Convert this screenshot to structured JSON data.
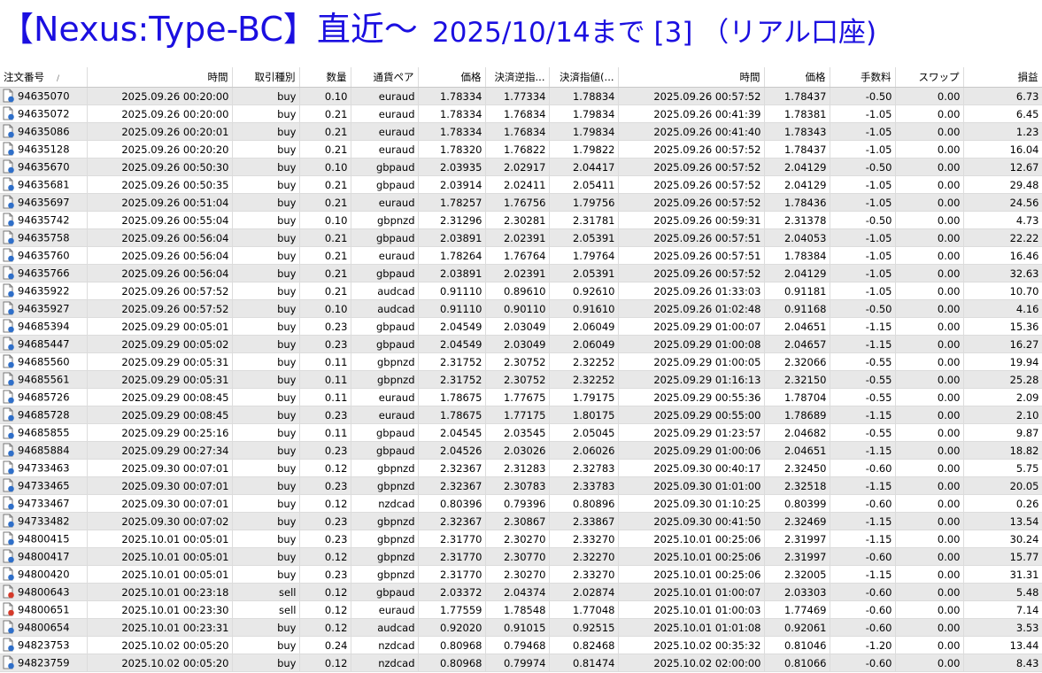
{
  "title": {
    "part1": "【Nexus:Type-BC】直近～",
    "part2": "2025/10/14まで [3] （リアル口座)"
  },
  "table": {
    "headers": [
      "注文番号",
      "時間",
      "取引種別",
      "数量",
      "通貨ペア",
      "価格",
      "決済逆指...",
      "決済指値(...",
      "時間",
      "価格",
      "手数料",
      "スワップ",
      "損益"
    ],
    "sort_indicator": "/",
    "colors": {
      "buy_icon": "#2f6fc9",
      "sell_icon": "#d53a2a"
    },
    "rows": [
      [
        "94635070",
        "2025.09.26 00:20:00",
        "buy",
        "0.10",
        "euraud",
        "1.78334",
        "1.77334",
        "1.78834",
        "2025.09.26 00:57:52",
        "1.78437",
        "-0.50",
        "0.00",
        "6.73"
      ],
      [
        "94635072",
        "2025.09.26 00:20:00",
        "buy",
        "0.21",
        "euraud",
        "1.78334",
        "1.76834",
        "1.79834",
        "2025.09.26 00:41:39",
        "1.78381",
        "-1.05",
        "0.00",
        "6.45"
      ],
      [
        "94635086",
        "2025.09.26 00:20:01",
        "buy",
        "0.21",
        "euraud",
        "1.78334",
        "1.76834",
        "1.79834",
        "2025.09.26 00:41:40",
        "1.78343",
        "-1.05",
        "0.00",
        "1.23"
      ],
      [
        "94635128",
        "2025.09.26 00:20:20",
        "buy",
        "0.21",
        "euraud",
        "1.78320",
        "1.76822",
        "1.79822",
        "2025.09.26 00:57:52",
        "1.78437",
        "-1.05",
        "0.00",
        "16.04"
      ],
      [
        "94635670",
        "2025.09.26 00:50:30",
        "buy",
        "0.10",
        "gbpaud",
        "2.03935",
        "2.02917",
        "2.04417",
        "2025.09.26 00:57:52",
        "2.04129",
        "-0.50",
        "0.00",
        "12.67"
      ],
      [
        "94635681",
        "2025.09.26 00:50:35",
        "buy",
        "0.21",
        "gbpaud",
        "2.03914",
        "2.02411",
        "2.05411",
        "2025.09.26 00:57:52",
        "2.04129",
        "-1.05",
        "0.00",
        "29.48"
      ],
      [
        "94635697",
        "2025.09.26 00:51:04",
        "buy",
        "0.21",
        "euraud",
        "1.78257",
        "1.76756",
        "1.79756",
        "2025.09.26 00:57:52",
        "1.78436",
        "-1.05",
        "0.00",
        "24.56"
      ],
      [
        "94635742",
        "2025.09.26 00:55:04",
        "buy",
        "0.10",
        "gbpnzd",
        "2.31296",
        "2.30281",
        "2.31781",
        "2025.09.26 00:59:31",
        "2.31378",
        "-0.50",
        "0.00",
        "4.73"
      ],
      [
        "94635758",
        "2025.09.26 00:56:04",
        "buy",
        "0.21",
        "gbpaud",
        "2.03891",
        "2.02391",
        "2.05391",
        "2025.09.26 00:57:51",
        "2.04053",
        "-1.05",
        "0.00",
        "22.22"
      ],
      [
        "94635760",
        "2025.09.26 00:56:04",
        "buy",
        "0.21",
        "euraud",
        "1.78264",
        "1.76764",
        "1.79764",
        "2025.09.26 00:57:51",
        "1.78384",
        "-1.05",
        "0.00",
        "16.46"
      ],
      [
        "94635766",
        "2025.09.26 00:56:04",
        "buy",
        "0.21",
        "gbpaud",
        "2.03891",
        "2.02391",
        "2.05391",
        "2025.09.26 00:57:52",
        "2.04129",
        "-1.05",
        "0.00",
        "32.63"
      ],
      [
        "94635922",
        "2025.09.26 00:57:52",
        "buy",
        "0.21",
        "audcad",
        "0.91110",
        "0.89610",
        "0.92610",
        "2025.09.26 01:33:03",
        "0.91181",
        "-1.05",
        "0.00",
        "10.70"
      ],
      [
        "94635927",
        "2025.09.26 00:57:52",
        "buy",
        "0.10",
        "audcad",
        "0.91110",
        "0.90110",
        "0.91610",
        "2025.09.26 01:02:48",
        "0.91168",
        "-0.50",
        "0.00",
        "4.16"
      ],
      [
        "94685394",
        "2025.09.29 00:05:01",
        "buy",
        "0.23",
        "gbpaud",
        "2.04549",
        "2.03049",
        "2.06049",
        "2025.09.29 01:00:07",
        "2.04651",
        "-1.15",
        "0.00",
        "15.36"
      ],
      [
        "94685447",
        "2025.09.29 00:05:02",
        "buy",
        "0.23",
        "gbpaud",
        "2.04549",
        "2.03049",
        "2.06049",
        "2025.09.29 01:00:08",
        "2.04657",
        "-1.15",
        "0.00",
        "16.27"
      ],
      [
        "94685560",
        "2025.09.29 00:05:31",
        "buy",
        "0.11",
        "gbpnzd",
        "2.31752",
        "2.30752",
        "2.32252",
        "2025.09.29 01:00:05",
        "2.32066",
        "-0.55",
        "0.00",
        "19.94"
      ],
      [
        "94685561",
        "2025.09.29 00:05:31",
        "buy",
        "0.11",
        "gbpnzd",
        "2.31752",
        "2.30752",
        "2.32252",
        "2025.09.29 01:16:13",
        "2.32150",
        "-0.55",
        "0.00",
        "25.28"
      ],
      [
        "94685726",
        "2025.09.29 00:08:45",
        "buy",
        "0.11",
        "euraud",
        "1.78675",
        "1.77675",
        "1.79175",
        "2025.09.29 00:55:36",
        "1.78704",
        "-0.55",
        "0.00",
        "2.09"
      ],
      [
        "94685728",
        "2025.09.29 00:08:45",
        "buy",
        "0.23",
        "euraud",
        "1.78675",
        "1.77175",
        "1.80175",
        "2025.09.29 00:55:00",
        "1.78689",
        "-1.15",
        "0.00",
        "2.10"
      ],
      [
        "94685855",
        "2025.09.29 00:25:16",
        "buy",
        "0.11",
        "gbpaud",
        "2.04545",
        "2.03545",
        "2.05045",
        "2025.09.29 01:23:57",
        "2.04682",
        "-0.55",
        "0.00",
        "9.87"
      ],
      [
        "94685884",
        "2025.09.29 00:27:34",
        "buy",
        "0.23",
        "gbpaud",
        "2.04526",
        "2.03026",
        "2.06026",
        "2025.09.29 01:00:06",
        "2.04651",
        "-1.15",
        "0.00",
        "18.82"
      ],
      [
        "94733463",
        "2025.09.30 00:07:01",
        "buy",
        "0.12",
        "gbpnzd",
        "2.32367",
        "2.31283",
        "2.32783",
        "2025.09.30 00:40:17",
        "2.32450",
        "-0.60",
        "0.00",
        "5.75"
      ],
      [
        "94733465",
        "2025.09.30 00:07:01",
        "buy",
        "0.23",
        "gbpnzd",
        "2.32367",
        "2.30783",
        "2.33783",
        "2025.09.30 01:01:00",
        "2.32518",
        "-1.15",
        "0.00",
        "20.05"
      ],
      [
        "94733467",
        "2025.09.30 00:07:01",
        "buy",
        "0.12",
        "nzdcad",
        "0.80396",
        "0.79396",
        "0.80896",
        "2025.09.30 01:10:25",
        "0.80399",
        "-0.60",
        "0.00",
        "0.26"
      ],
      [
        "94733482",
        "2025.09.30 00:07:02",
        "buy",
        "0.23",
        "gbpnzd",
        "2.32367",
        "2.30867",
        "2.33867",
        "2025.09.30 00:41:50",
        "2.32469",
        "-1.15",
        "0.00",
        "13.54"
      ],
      [
        "94800415",
        "2025.10.01 00:05:01",
        "buy",
        "0.23",
        "gbpnzd",
        "2.31770",
        "2.30270",
        "2.33270",
        "2025.10.01 00:25:06",
        "2.31997",
        "-1.15",
        "0.00",
        "30.24"
      ],
      [
        "94800417",
        "2025.10.01 00:05:01",
        "buy",
        "0.12",
        "gbpnzd",
        "2.31770",
        "2.30770",
        "2.32270",
        "2025.10.01 00:25:06",
        "2.31997",
        "-0.60",
        "0.00",
        "15.77"
      ],
      [
        "94800420",
        "2025.10.01 00:05:01",
        "buy",
        "0.23",
        "gbpnzd",
        "2.31770",
        "2.30270",
        "2.33270",
        "2025.10.01 00:25:06",
        "2.32005",
        "-1.15",
        "0.00",
        "31.31"
      ],
      [
        "94800643",
        "2025.10.01 00:23:18",
        "sell",
        "0.12",
        "gbpaud",
        "2.03372",
        "2.04374",
        "2.02874",
        "2025.10.01 01:00:07",
        "2.03303",
        "-0.60",
        "0.00",
        "5.48"
      ],
      [
        "94800651",
        "2025.10.01 00:23:30",
        "sell",
        "0.12",
        "euraud",
        "1.77559",
        "1.78548",
        "1.77048",
        "2025.10.01 01:00:03",
        "1.77469",
        "-0.60",
        "0.00",
        "7.14"
      ],
      [
        "94800654",
        "2025.10.01 00:23:31",
        "buy",
        "0.12",
        "audcad",
        "0.92020",
        "0.91015",
        "0.92515",
        "2025.10.01 01:01:08",
        "0.92061",
        "-0.60",
        "0.00",
        "3.53"
      ],
      [
        "94823753",
        "2025.10.02 00:05:20",
        "buy",
        "0.24",
        "nzdcad",
        "0.80968",
        "0.79468",
        "0.82468",
        "2025.10.02 00:35:32",
        "0.81046",
        "-1.20",
        "0.00",
        "13.44"
      ],
      [
        "94823759",
        "2025.10.02 00:05:20",
        "buy",
        "0.12",
        "nzdcad",
        "0.80968",
        "0.79974",
        "0.81474",
        "2025.10.02 02:00:00",
        "0.81066",
        "-0.60",
        "0.00",
        "8.43"
      ]
    ]
  }
}
